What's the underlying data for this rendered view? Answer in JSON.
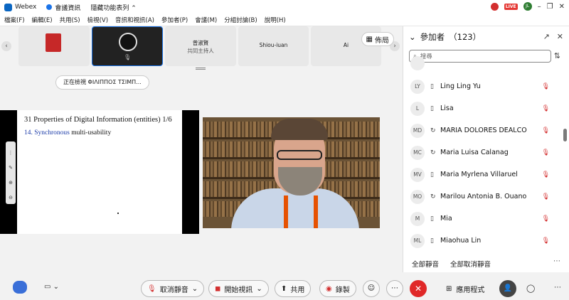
{
  "titlebar": {
    "app": "Webex",
    "meeting_info": "會議資訊",
    "hide_toolbar": "隱藏功能表列",
    "live": "LIVE",
    "user_initials": "JL"
  },
  "menu": [
    "檔案(F)",
    "編輯(E)",
    "共用(S)",
    "檢視(V)",
    "音訊和視訊(A)",
    "參加者(P)",
    "會議(M)",
    "分組討論(B)",
    "說明(H)"
  ],
  "thumbnails": [
    {
      "name": ""
    },
    {
      "name": ""
    },
    {
      "name": "曾淑賢",
      "role": "共同主持人"
    },
    {
      "name": "Shiou-iuan"
    },
    {
      "name": "Ai"
    }
  ],
  "layout_button": "佈局",
  "viewing": "正在檢視 ΦΙΛΙΠΠΟΣ ΤΣΙΜΠ...",
  "shared_doc": {
    "heading": "31 Properties of Digital Information (entities) 1/6",
    "item_number": "14.",
    "item_keyword": "Synchronous",
    "item_rest": " multi-usability"
  },
  "participants": {
    "title": "參加者",
    "count": "（123）",
    "search_placeholder": "搜尋",
    "items": [
      {
        "initials": "LY",
        "device": "phone",
        "name": "Ling Ling Yu"
      },
      {
        "initials": "L",
        "device": "phone",
        "name": "Lisa"
      },
      {
        "initials": "MD",
        "device": "sync",
        "name": "MARIA DOLORES DEALCO"
      },
      {
        "initials": "MC",
        "device": "sync",
        "name": "Maria Luisa Calanag"
      },
      {
        "initials": "MV",
        "device": "phone",
        "name": "Maria Myrlena Villaruel"
      },
      {
        "initials": "MO",
        "device": "sync",
        "name": "Marilou Antonia B. Ouano"
      },
      {
        "initials": "M",
        "device": "phone",
        "name": "Mia"
      },
      {
        "initials": "ML",
        "device": "phone",
        "name": "Miaohua Lin"
      }
    ],
    "mute_all": "全部靜音",
    "unmute_all": "全部取消靜音"
  },
  "controls": {
    "unmute": "取消靜音",
    "start_video": "開始視訊",
    "share": "共用",
    "record": "錄製",
    "apps": "應用程式"
  }
}
